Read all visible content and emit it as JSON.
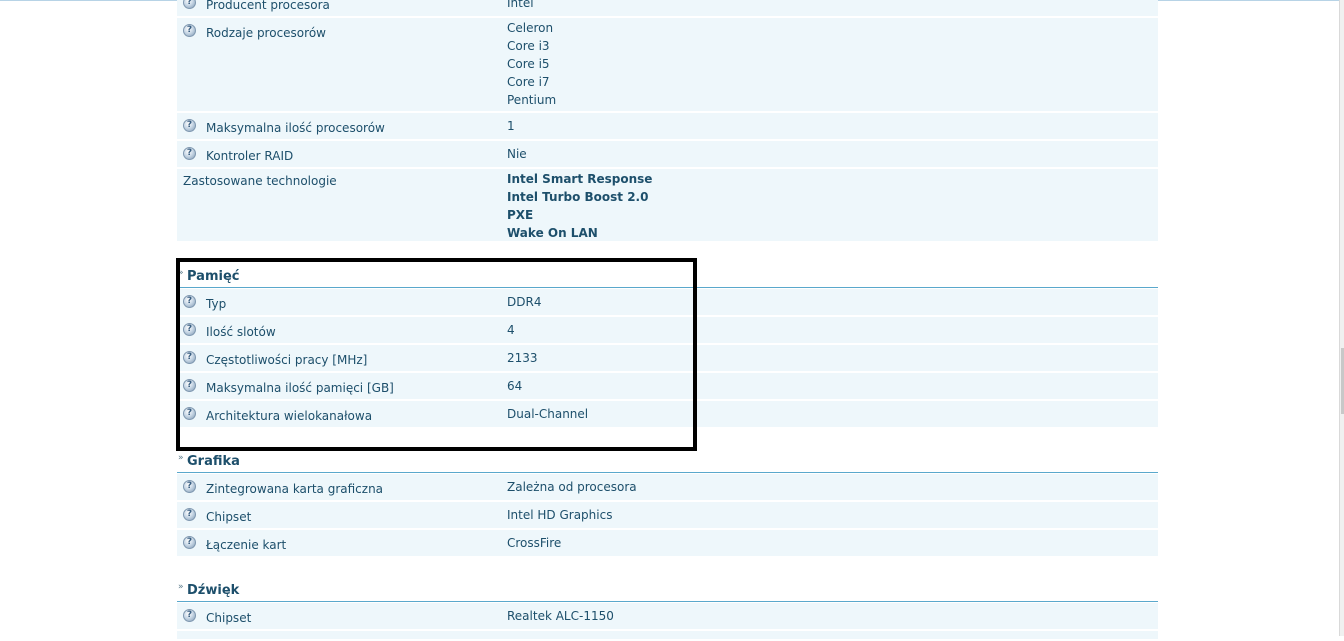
{
  "spec_rows_top": [
    {
      "label": "Producent procesora",
      "values": [
        "Intel"
      ]
    },
    {
      "label": "Rodzaje procesorów",
      "values": [
        "Celeron",
        "Core i3",
        "Core i5",
        "Core i7",
        "Pentium"
      ]
    },
    {
      "label": "Maksymalna ilość procesorów",
      "values": [
        "1"
      ]
    },
    {
      "label": "Kontroler RAID",
      "values": [
        "Nie"
      ]
    },
    {
      "label": "Zastosowane technologie",
      "values": [
        "Intel Smart Response",
        "Intel Turbo Boost 2.0",
        "PXE",
        "Wake On LAN"
      ]
    }
  ],
  "memory": {
    "title": "Pamięć",
    "rows": [
      {
        "label": "Typ",
        "value": "DDR4"
      },
      {
        "label": "Ilość slotów",
        "value": "4"
      },
      {
        "label": "Częstotliwości pracy [MHz]",
        "value": "2133"
      },
      {
        "label": "Maksymalna ilość pamięci [GB]",
        "value": "64"
      },
      {
        "label": "Architektura wielokanałowa",
        "value": "Dual-Channel"
      }
    ]
  },
  "graphics": {
    "title": "Grafika",
    "rows": [
      {
        "label": "Zintegrowana karta graficzna",
        "value": "Zależna od procesora"
      },
      {
        "label": "Chipset",
        "value": "Intel HD Graphics"
      },
      {
        "label": "Łączenie kart",
        "value": "CrossFire"
      }
    ]
  },
  "sound": {
    "title": "Dźwięk",
    "rows": [
      {
        "label": "Chipset",
        "value": "Realtek ALC-1150"
      }
    ]
  },
  "icons": {
    "info": "info-icon",
    "section_marker": "double-chevron-icon"
  },
  "colors": {
    "text": "#1d4f6b",
    "row_bg": "#eef7fb",
    "section_rule": "#5aa8cc",
    "highlight": "#000000"
  }
}
